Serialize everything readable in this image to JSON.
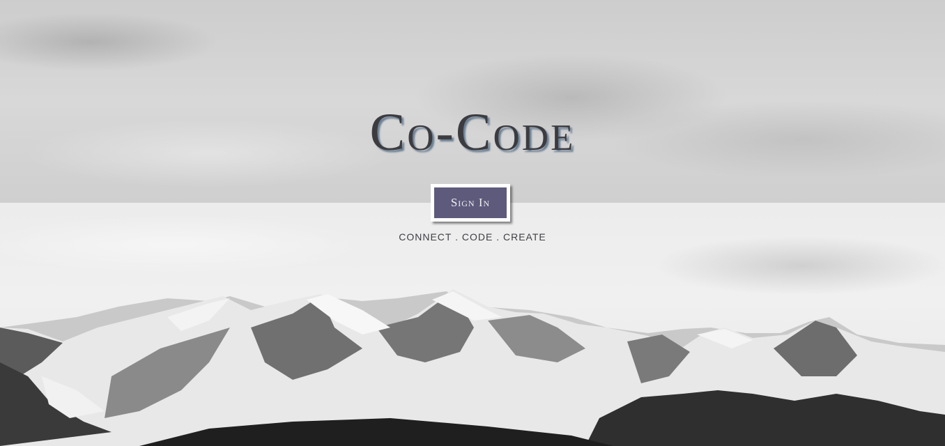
{
  "hero": {
    "title": "Co-Code",
    "signin_label": "Sign In",
    "tagline": "CONNECT . CODE . CREATE",
    "background_image": "snowy-mountain-range-grayscale"
  },
  "colors": {
    "button_bg": "#5d5a7c",
    "button_border": "#ffffff",
    "title_text": "#3c3c40",
    "title_shadow": "#6a7e93"
  }
}
